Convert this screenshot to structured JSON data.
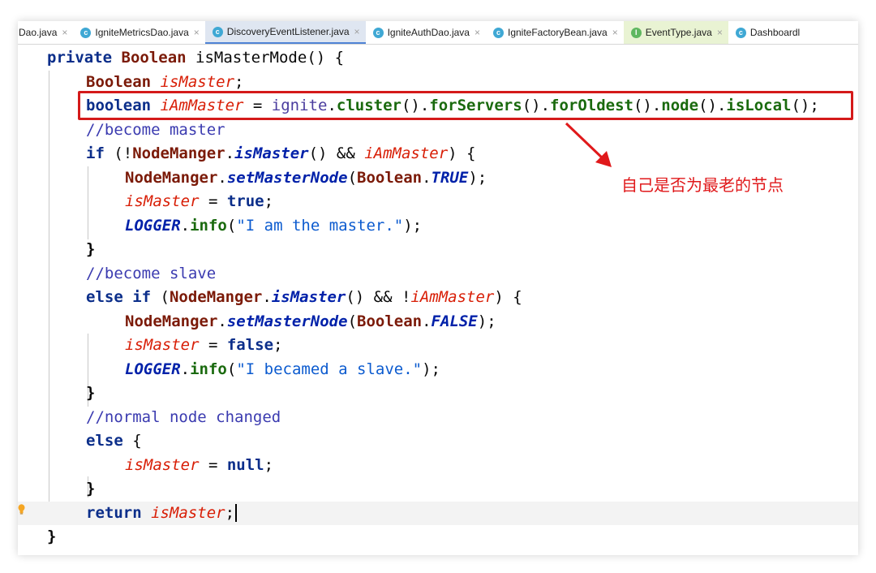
{
  "tabs": [
    {
      "label": "Dao.java",
      "icon": "class-icon",
      "active": false
    },
    {
      "label": "IgniteMetricsDao.java",
      "icon": "class-icon",
      "active": false
    },
    {
      "label": "DiscoveryEventListener.java",
      "icon": "class-icon",
      "active": true
    },
    {
      "label": "IgniteAuthDao.java",
      "icon": "class-icon",
      "active": false
    },
    {
      "label": "IgniteFactoryBean.java",
      "icon": "class-icon",
      "active": false
    },
    {
      "label": "EventType.java",
      "icon": "interface-icon",
      "active": false
    },
    {
      "label": "Dashboardl",
      "icon": "class-icon",
      "active": false
    }
  ],
  "tab_icon_letters": {
    "class": "c",
    "interface": "I"
  },
  "tab_close_glyph": "×",
  "code": {
    "l1": {
      "a": "private ",
      "b": "Boolean ",
      "c": "isMasterMode",
      "d": "() {"
    },
    "l2": {
      "a": "Boolean ",
      "b": "isMaster",
      "c": ";"
    },
    "l3": {
      "a": "boolean ",
      "b": "iAmMaster",
      "c": " = ",
      "d": "ignite",
      "e": ".",
      "f": "cluster",
      "g": "().",
      "h": "forServers",
      "i": "().",
      "j": "forOldest",
      "k": "().",
      "l": "node",
      "m": "().",
      "n": "isLocal",
      "o": "();"
    },
    "l4": {
      "a": "//become master"
    },
    "l5": {
      "a": "if ",
      "b": "(!",
      "c": "NodeManger",
      "d": ".",
      "e": "isMaster",
      "f": "() && ",
      "g": "iAmMaster",
      "h": ") {"
    },
    "l6": {
      "a": "NodeManger",
      "b": ".",
      "c": "setMasterNode",
      "d": "(",
      "e": "Boolean",
      "f": ".",
      "g": "TRUE",
      "h": ");"
    },
    "l7": {
      "a": "isMaster",
      "b": " = ",
      "c": "true",
      "d": ";"
    },
    "l8": {
      "a": "LOGGER",
      "b": ".",
      "c": "info",
      "d": "(",
      "e": "\"I am the master.\"",
      "f": ");"
    },
    "l9": {
      "a": "}"
    },
    "l10": {
      "a": "//become slave"
    },
    "l11": {
      "a": "else if ",
      "b": "(",
      "c": "NodeManger",
      "d": ".",
      "e": "isMaster",
      "f": "() && !",
      "g": "iAmMaster",
      "h": ") {"
    },
    "l12": {
      "a": "NodeManger",
      "b": ".",
      "c": "setMasterNode",
      "d": "(",
      "e": "Boolean",
      "f": ".",
      "g": "FALSE",
      "h": ");"
    },
    "l13": {
      "a": "isMaster",
      "b": " = ",
      "c": "false",
      "d": ";"
    },
    "l14": {
      "a": "LOGGER",
      "b": ".",
      "c": "info",
      "d": "(",
      "e": "\"I becamed a slave.\"",
      "f": ");"
    },
    "l15": {
      "a": "}"
    },
    "l16": {
      "a": "//normal node changed"
    },
    "l17": {
      "a": "else ",
      "b": "{"
    },
    "l18": {
      "a": "isMaster",
      "b": " = ",
      "c": "null",
      "d": ";"
    },
    "l19": {
      "a": "}"
    },
    "l20": {
      "a": "return ",
      "b": "isMaster",
      "c": ";"
    },
    "l21": {
      "a": "}"
    }
  },
  "annotation": {
    "text": "自己是否为最老的节点",
    "color": "#e0191b"
  },
  "colors": {
    "highlight_box": "#d41a1a",
    "active_tab": "#dfe6f1",
    "keyword": "#0b2e8a",
    "local_var": "#d81e06"
  }
}
